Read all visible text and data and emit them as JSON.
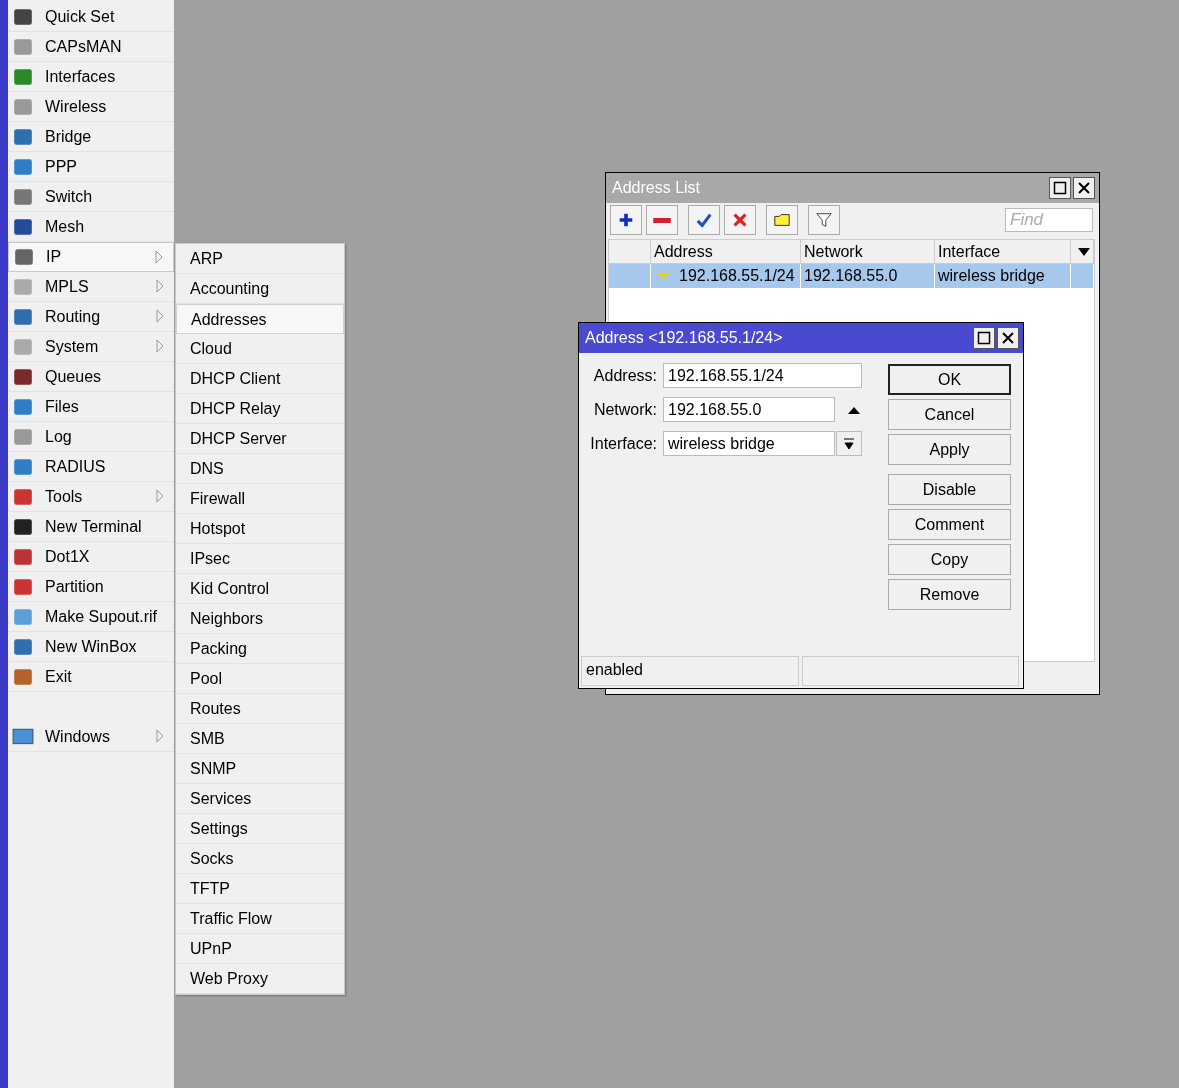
{
  "menu": {
    "items": [
      {
        "label": "Quick Set",
        "submenu": false,
        "selected": false
      },
      {
        "label": "CAPsMAN",
        "submenu": false,
        "selected": false
      },
      {
        "label": "Interfaces",
        "submenu": false,
        "selected": false
      },
      {
        "label": "Wireless",
        "submenu": false,
        "selected": false
      },
      {
        "label": "Bridge",
        "submenu": false,
        "selected": false
      },
      {
        "label": "PPP",
        "submenu": false,
        "selected": false
      },
      {
        "label": "Switch",
        "submenu": false,
        "selected": false
      },
      {
        "label": "Mesh",
        "submenu": false,
        "selected": false
      },
      {
        "label": "IP",
        "submenu": true,
        "selected": true
      },
      {
        "label": "MPLS",
        "submenu": true,
        "selected": false
      },
      {
        "label": "Routing",
        "submenu": true,
        "selected": false
      },
      {
        "label": "System",
        "submenu": true,
        "selected": false
      },
      {
        "label": "Queues",
        "submenu": false,
        "selected": false
      },
      {
        "label": "Files",
        "submenu": false,
        "selected": false
      },
      {
        "label": "Log",
        "submenu": false,
        "selected": false
      },
      {
        "label": "RADIUS",
        "submenu": false,
        "selected": false
      },
      {
        "label": "Tools",
        "submenu": true,
        "selected": false
      },
      {
        "label": "New Terminal",
        "submenu": false,
        "selected": false
      },
      {
        "label": "Dot1X",
        "submenu": false,
        "selected": false
      },
      {
        "label": "Partition",
        "submenu": false,
        "selected": false
      },
      {
        "label": "Make Supout.rif",
        "submenu": false,
        "selected": false
      },
      {
        "label": "New WinBox",
        "submenu": false,
        "selected": false
      },
      {
        "label": "Exit",
        "submenu": false,
        "selected": false
      }
    ],
    "bottom_items": [
      {
        "label": "Windows",
        "submenu": true,
        "selected": false
      }
    ]
  },
  "submenu": {
    "items": [
      {
        "label": "ARP",
        "selected": false
      },
      {
        "label": "Accounting",
        "selected": false
      },
      {
        "label": "Addresses",
        "selected": true
      },
      {
        "label": "Cloud",
        "selected": false
      },
      {
        "label": "DHCP Client",
        "selected": false
      },
      {
        "label": "DHCP Relay",
        "selected": false
      },
      {
        "label": "DHCP Server",
        "selected": false
      },
      {
        "label": "DNS",
        "selected": false
      },
      {
        "label": "Firewall",
        "selected": false
      },
      {
        "label": "Hotspot",
        "selected": false
      },
      {
        "label": "IPsec",
        "selected": false
      },
      {
        "label": "Kid Control",
        "selected": false
      },
      {
        "label": "Neighbors",
        "selected": false
      },
      {
        "label": "Packing",
        "selected": false
      },
      {
        "label": "Pool",
        "selected": false
      },
      {
        "label": "Routes",
        "selected": false
      },
      {
        "label": "SMB",
        "selected": false
      },
      {
        "label": "SNMP",
        "selected": false
      },
      {
        "label": "Services",
        "selected": false
      },
      {
        "label": "Settings",
        "selected": false
      },
      {
        "label": "Socks",
        "selected": false
      },
      {
        "label": "TFTP",
        "selected": false
      },
      {
        "label": "Traffic Flow",
        "selected": false
      },
      {
        "label": "UPnP",
        "selected": false
      },
      {
        "label": "Web Proxy",
        "selected": false
      }
    ]
  },
  "address_list": {
    "title": "Address List",
    "search": {
      "placeholder": "Find"
    },
    "table": {
      "columns": [
        "Address",
        "Network",
        "Interface"
      ],
      "rows": [
        {
          "cells": [
            "192.168.55.1/24",
            "192.168.55.0",
            "wireless bridge"
          ],
          "selected": true
        }
      ]
    }
  },
  "address_dialog": {
    "title": "Address <192.168.55.1/24>",
    "fields": [
      {
        "label": "Address:",
        "value": "192.168.55.1/24",
        "kind": "plain"
      },
      {
        "label": "Network:",
        "value": "192.168.55.0",
        "kind": "collapse"
      },
      {
        "label": "Interface:",
        "value": "wireless bridge",
        "kind": "dropdown"
      }
    ],
    "buttons": [
      {
        "label": "OK",
        "default": true
      },
      {
        "label": "Cancel",
        "default": false
      },
      {
        "label": "Apply",
        "default": false
      },
      {
        "label": "Disable",
        "default": false
      },
      {
        "label": "Comment",
        "default": false
      },
      {
        "label": "Copy",
        "default": false
      },
      {
        "label": "Remove",
        "default": false
      }
    ],
    "status_bar": [
      "enabled"
    ]
  }
}
